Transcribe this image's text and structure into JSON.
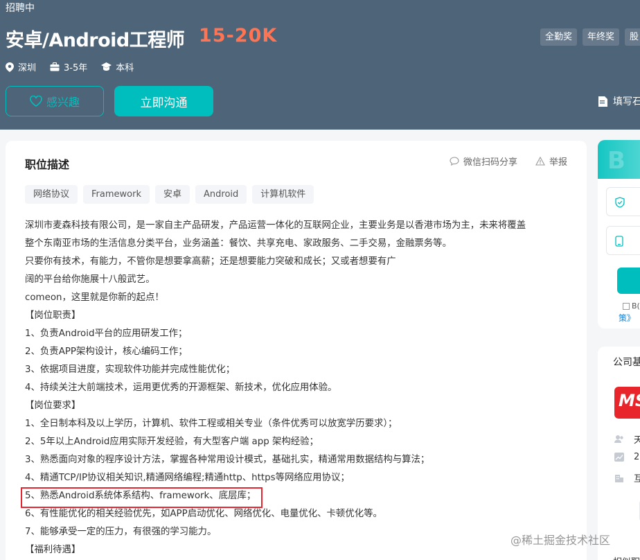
{
  "header": {
    "status": "招聘中",
    "job_title": "安卓/Android工程师",
    "salary": "15-20K",
    "meta": [
      {
        "icon": "location-icon",
        "text": "深圳"
      },
      {
        "icon": "briefcase-icon",
        "text": "3-5年"
      },
      {
        "icon": "graduation-cap-icon",
        "text": "本科"
      }
    ],
    "benefits": [
      "全勤奖",
      "年终奖",
      "股"
    ],
    "interest_label": "感兴趣",
    "chat_label": "立即沟通",
    "fill_resume_label": "填写石",
    "colors": {
      "header_bg": "#4e6478",
      "accent": "#00bebd",
      "salary": "#ff7452"
    }
  },
  "job": {
    "section_title": "职位描述",
    "share_label": "微信扫码分享",
    "report_label": "举报",
    "tags": [
      "网络协议",
      "Framework",
      "安卓",
      "Android",
      "计算机软件"
    ],
    "description_lines": [
      "深圳市麦森科技有限公司，是一家自主产品研发，产品运营一体化的互联网企业，主要业务是以香港市场为主，未来将覆盖",
      "整个东南亚市场的生活信息分类平台，业务涵盖：餐饮、共享充电、家政服务、二手交易，金融票务等。",
      "只要你有技术，有能力，不管你是想要拿高薪；还是想要能力突破和成长；又或者想要有广",
      "阔的平台给你施展十八般武艺。",
      "comeon，这里就是你新的起点！",
      "【岗位职责】",
      "1、负责Android平台的应用研发工作；",
      "2、负责APP架构设计，核心编码工作；",
      "3、依据项目进度，实现软件功能并完成性能优化；",
      "4、持续关注大前端技术，运用更优秀的开源框架、新技术，优化应用体验。",
      "【岗位要求】",
      "1、全日制本科及以上学历，计算机、软件工程或相关专业（条件优秀可以放宽学历要求）；",
      "2、5年以上Android应用实际开发经验，有大型客户端 app 架构经验；",
      "3、熟悉面向对象的程序设计方法，掌握各种常用设计模式，基础扎实，精通常用数据结构与算法；",
      "4、精通TCP/IP协议相关知识,精通网络编程;精通http、https等网络应用协议；",
      "5、熟悉Android系统体系结构、framework、底层库；",
      "6、有性能优化的相关经验优先，如APP启动优化、网络优化、电量优化、卡顿优化等。",
      "7、能够承受一定的压力，有很强的学习能力。",
      "【福利待遇】"
    ]
  },
  "sidebar": {
    "band_text": "B",
    "checkbox_label": "B(",
    "policy_link": "策》",
    "company_title": "公司基",
    "logo_text": "MS",
    "info_rows": [
      {
        "icon": "people-icon",
        "text": "天"
      },
      {
        "icon": "trend-icon",
        "text": "2"
      },
      {
        "icon": "building-icon",
        "text": "互"
      }
    ],
    "bottom_text": "相似职"
  },
  "watermark": "@稀土掘金技术社区"
}
